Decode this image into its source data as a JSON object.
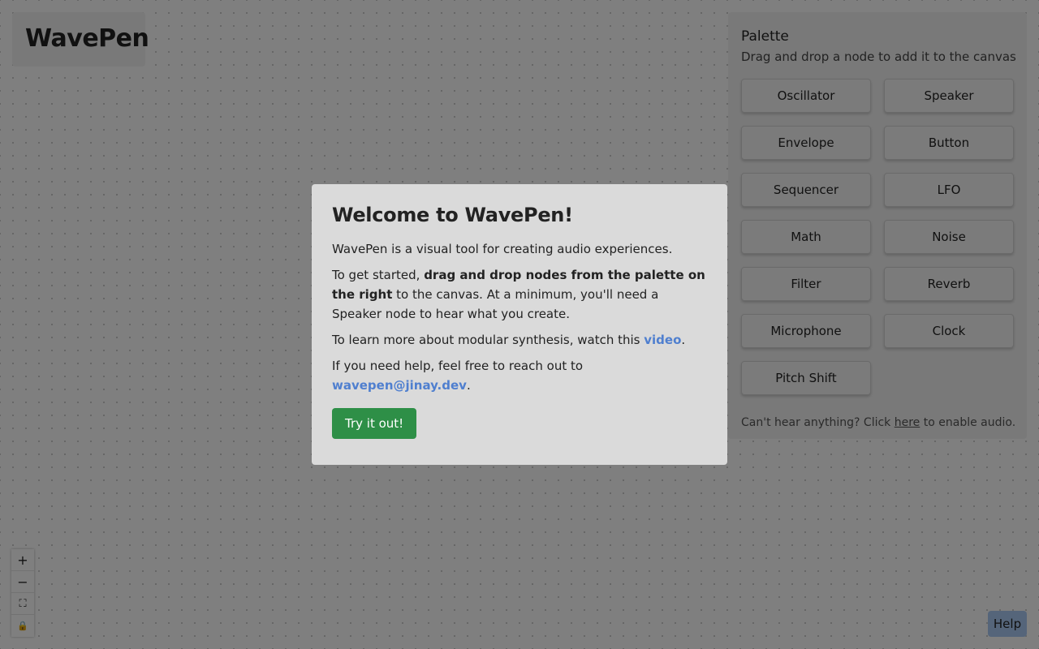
{
  "app": {
    "title": "WavePen"
  },
  "palette": {
    "title": "Palette",
    "subtitle": "Drag and drop a node to add it to the canvas",
    "nodes": [
      "Oscillator",
      "Speaker",
      "Envelope",
      "Button",
      "Sequencer",
      "LFO",
      "Math",
      "Noise",
      "Filter",
      "Reverb",
      "Microphone",
      "Clock",
      "Pitch Shift"
    ],
    "audio_note": {
      "prefix": "Can't hear anything? Click ",
      "link": "here",
      "suffix": " to enable audio."
    }
  },
  "canvas_controls": {
    "zoom_in": "+",
    "zoom_out": "−",
    "fit_view": "⛶",
    "lock": "🔒",
    "icons": [
      "plus-icon",
      "minus-icon",
      "fit-view-icon",
      "lock-icon"
    ]
  },
  "help": {
    "label": "Help"
  },
  "modal": {
    "title": "Welcome to WavePen!",
    "intro": "WavePen is a visual tool for creating audio experiences.",
    "start_prefix": "To get started, ",
    "start_bold": "drag and drop nodes from the palette on the right",
    "start_suffix": " to the canvas. At a minimum, you'll need a Speaker node to hear what you create.",
    "learn_prefix": "To learn more about modular synthesis, watch this ",
    "learn_link": "video",
    "learn_suffix": ".",
    "help_prefix": "If you need help, feel free to reach out to ",
    "help_email": "wavepen@jinay.dev",
    "help_suffix": ".",
    "cta": "Try it out!"
  },
  "colors": {
    "overlay": "#000000",
    "modal_bg": "#dadada",
    "link": "#4f7fcf",
    "cta_bg": "#2e8f47",
    "help_bg": "#aacbf5"
  }
}
